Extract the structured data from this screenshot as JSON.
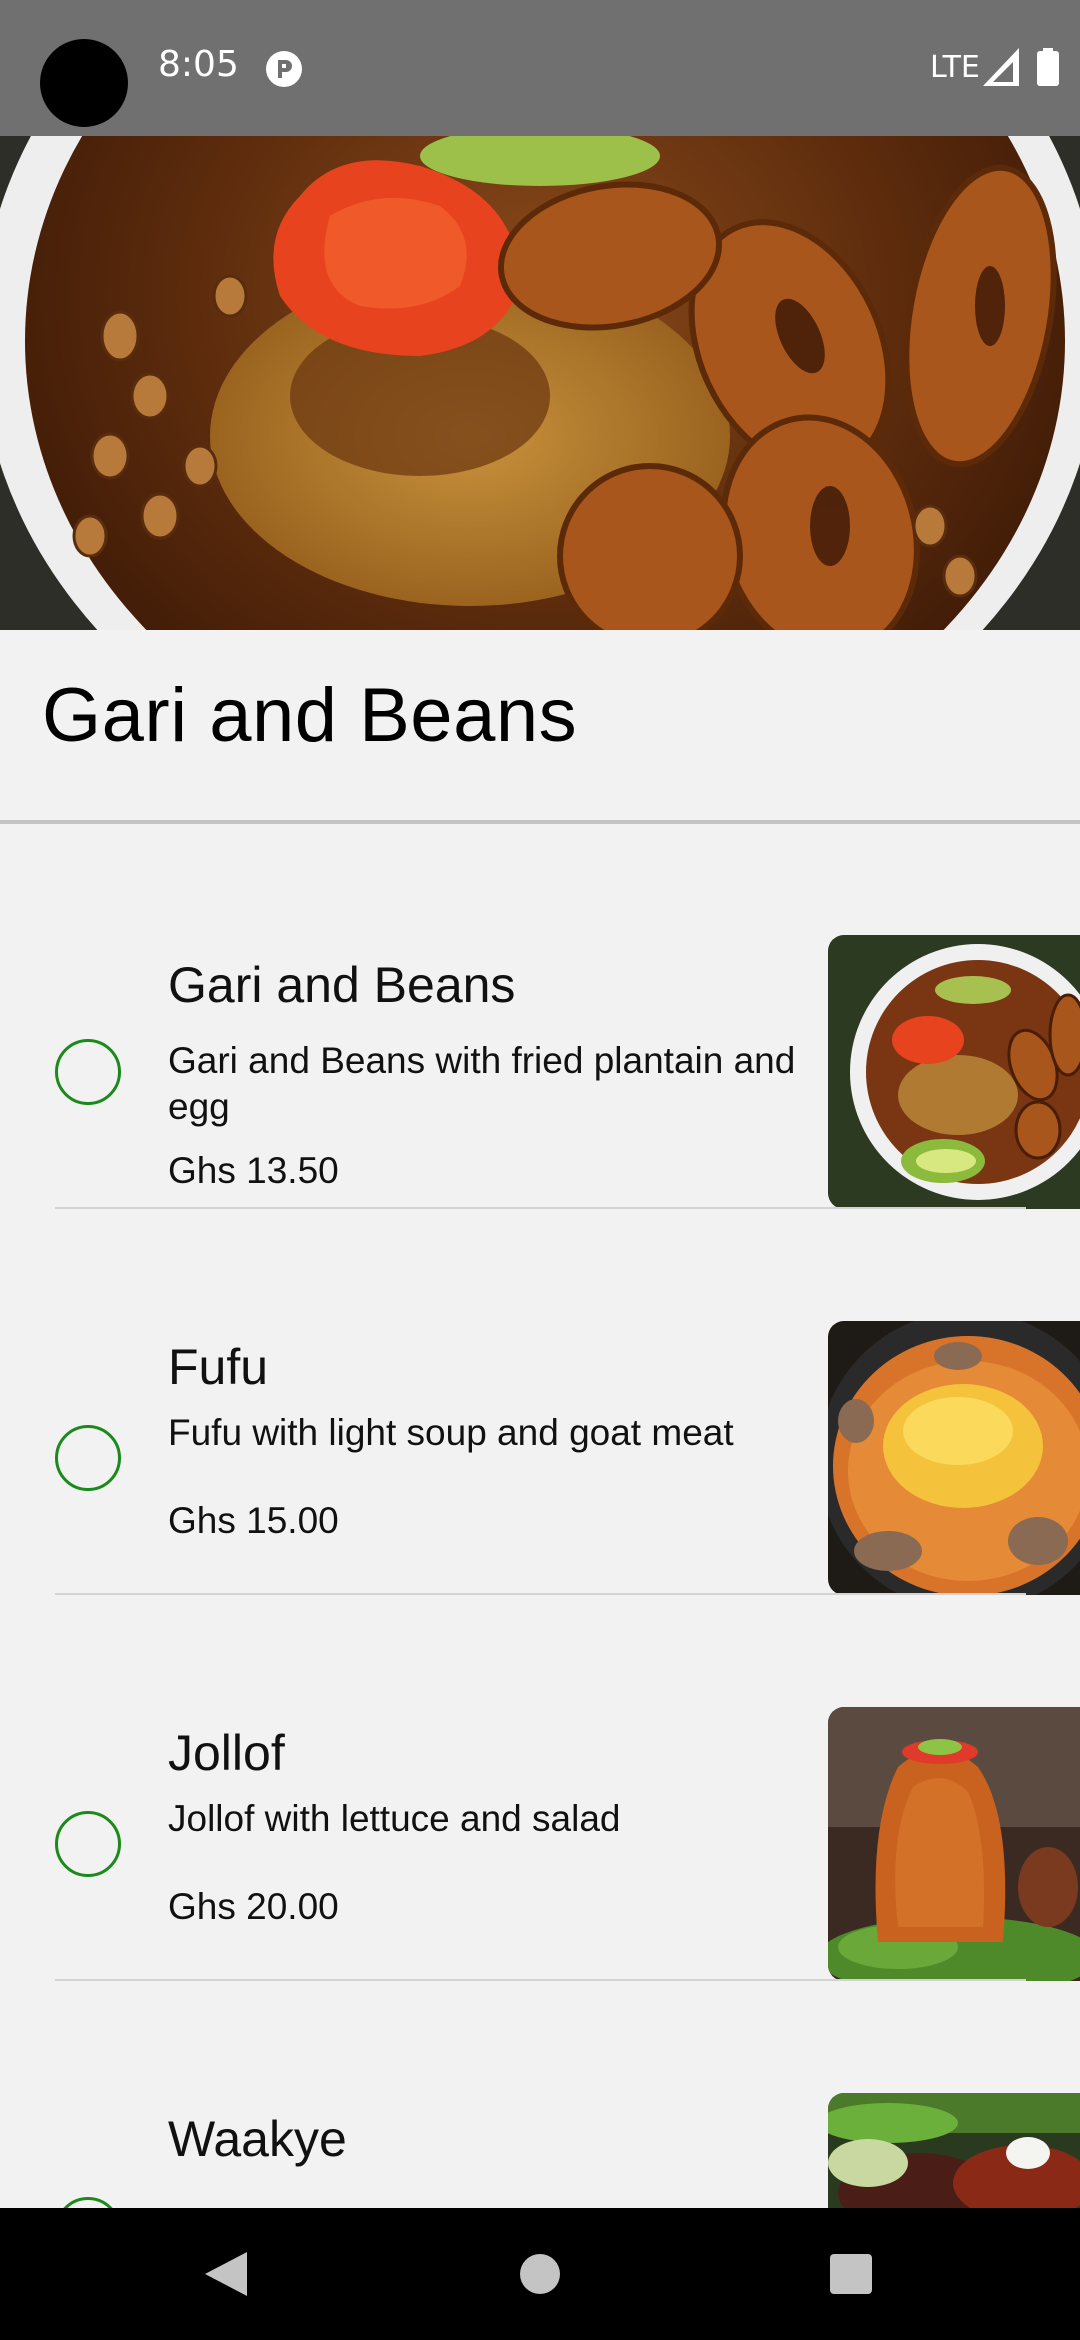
{
  "status_bar": {
    "time": "8:05",
    "network": "LTE",
    "app_icon": "pocket-casts-icon",
    "signal_icon": "signal-icon",
    "battery_icon": "battery-icon"
  },
  "dish": {
    "title": "Gari and Beans",
    "hero_image": "gari-and-beans-hero-image"
  },
  "menu": {
    "items": [
      {
        "name": "Gari and Beans",
        "description": "Gari and Beans with fried plantain and egg",
        "price": "Ghs 13.50",
        "selected": false,
        "thumbnail": "gari-and-beans-photo"
      },
      {
        "name": "Fufu",
        "description": "Fufu with light soup and goat meat",
        "price": "Ghs 15.00",
        "selected": false,
        "thumbnail": "fufu-photo"
      },
      {
        "name": "Jollof",
        "description": "Jollof with lettuce and salad",
        "price": "Ghs 20.00",
        "selected": false,
        "thumbnail": "jollof-photo"
      },
      {
        "name": "Waakye",
        "selected": false,
        "thumbnail": "waakye-photo"
      }
    ]
  },
  "nav_bar": {
    "back_icon": "back-icon",
    "home_icon": "home-icon",
    "recents_icon": "recents-icon"
  },
  "colors": {
    "radio_accent": "#1b8a1b",
    "background": "#f2f2f2",
    "status_bar": "#707070",
    "nav_bar": "#000000"
  }
}
